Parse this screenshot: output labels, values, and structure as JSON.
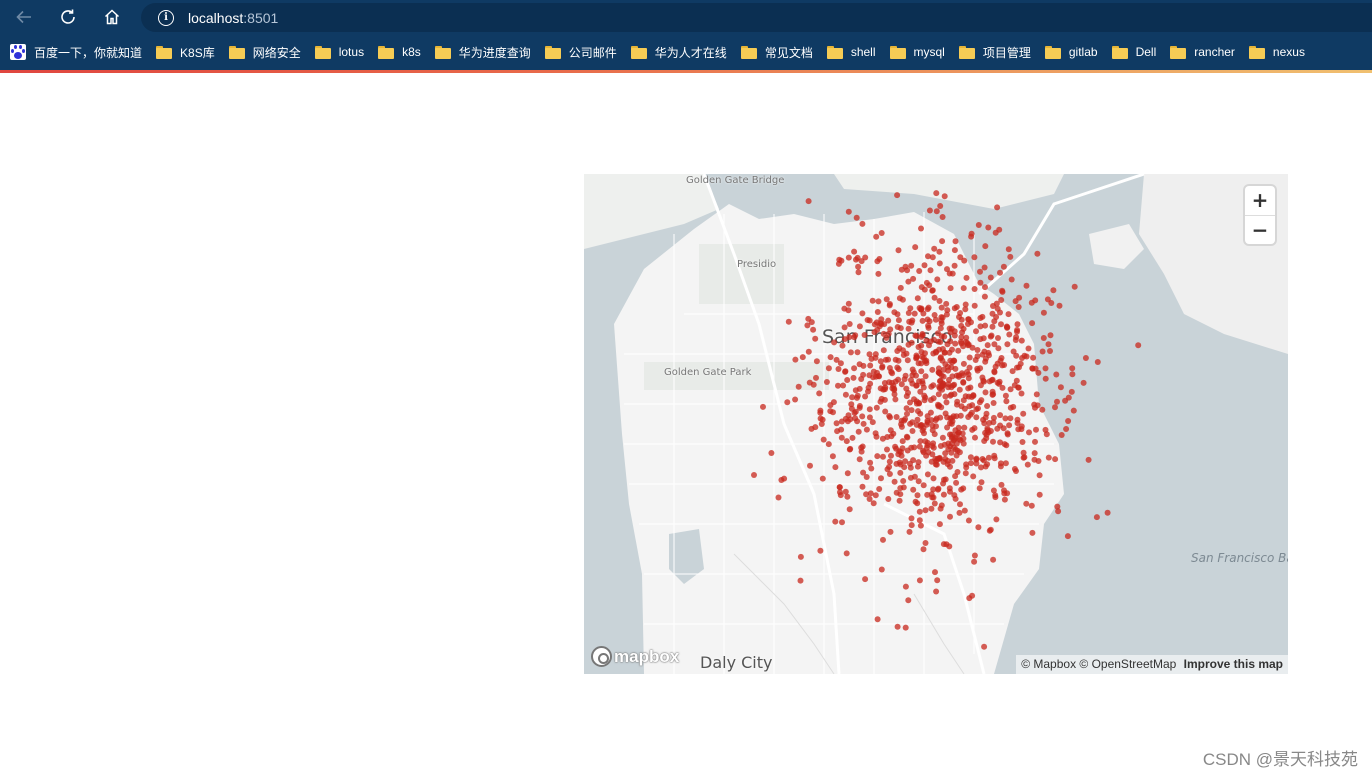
{
  "browser": {
    "url_host": "localhost",
    "url_port": ":8501",
    "bookmarks": [
      {
        "label": "百度一下，你就知道",
        "icon": "baidu-icon"
      },
      {
        "label": "K8S库",
        "icon": "folder-icon"
      },
      {
        "label": "网络安全",
        "icon": "folder-icon"
      },
      {
        "label": "lotus",
        "icon": "folder-icon"
      },
      {
        "label": "k8s",
        "icon": "folder-icon"
      },
      {
        "label": "华为进度查询",
        "icon": "folder-icon"
      },
      {
        "label": "公司邮件",
        "icon": "folder-icon"
      },
      {
        "label": "华为人才在线",
        "icon": "folder-icon"
      },
      {
        "label": "常见文档",
        "icon": "folder-icon"
      },
      {
        "label": "shell",
        "icon": "folder-icon"
      },
      {
        "label": "mysql",
        "icon": "folder-icon"
      },
      {
        "label": "项目管理",
        "icon": "folder-icon"
      },
      {
        "label": "gitlab",
        "icon": "folder-icon"
      },
      {
        "label": "Dell",
        "icon": "folder-icon"
      },
      {
        "label": "rancher",
        "icon": "folder-icon"
      },
      {
        "label": "nexus",
        "icon": "folder-icon"
      }
    ]
  },
  "map": {
    "labels": {
      "city": "San Francisco",
      "daly_city": "Daly City",
      "golden_gate_bridge": "Golden Gate Bridge",
      "presidio": "Presidio",
      "golden_gate_park": "Golden Gate Park",
      "bay": "San Francisco Bay"
    },
    "zoom_in": "+",
    "zoom_out": "−",
    "logo_text": "mapbox",
    "attribution": "© Mapbox © OpenStreetMap",
    "improve": "Improve this map",
    "colors": {
      "water": "#c9d3d8",
      "land": "#f4f4f4",
      "park": "#e8ebe8",
      "road": "#ffffff",
      "point": "#c8281e"
    },
    "point_cloud": {
      "center_lat": 37.7749,
      "center_lon": -122.4194,
      "count": 1000,
      "spread_lat": 0.02,
      "spread_lon": 0.02
    }
  },
  "watermark": "CSDN @景天科技苑"
}
